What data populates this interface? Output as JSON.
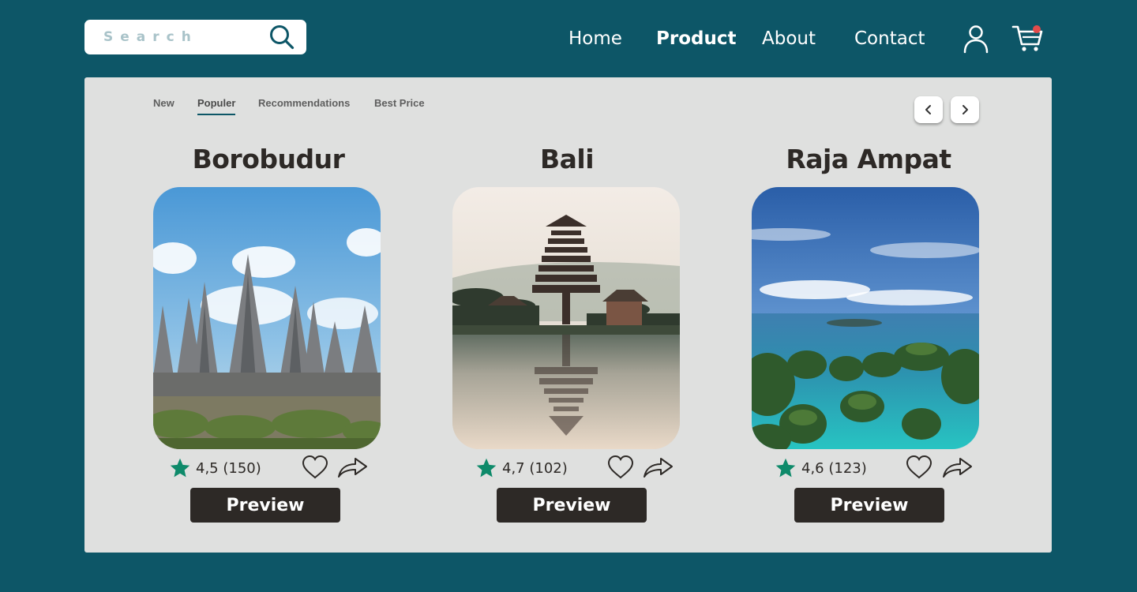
{
  "search": {
    "placeholder": "Search",
    "icon": "search-icon"
  },
  "nav": {
    "items": [
      {
        "label": "Home",
        "active": false
      },
      {
        "label": "Product",
        "active": true
      },
      {
        "label": "About",
        "active": false
      },
      {
        "label": "Contact",
        "active": false
      }
    ],
    "user_icon": "user-icon",
    "cart_icon": "cart-icon",
    "cart_badge_color": "#e24b4b"
  },
  "tabs": [
    {
      "label": "New",
      "active": false
    },
    {
      "label": "Populer",
      "active": true
    },
    {
      "label": "Recommendations",
      "active": false
    },
    {
      "label": "Best Price",
      "active": false
    }
  ],
  "carousel": {
    "prev_icon": "chevron-left-icon",
    "next_icon": "chevron-right-icon"
  },
  "cards": [
    {
      "title": "Borobudur",
      "rating": "4,5 (150)",
      "button": "Preview"
    },
    {
      "title": "Bali",
      "rating": "4,7 (102)",
      "button": "Preview"
    },
    {
      "title": "Raja Ampat",
      "rating": "4,6 (123)",
      "button": "Preview"
    }
  ],
  "colors": {
    "background": "#0d5667",
    "panel": "#dfe0df",
    "star": "#0e8a6a",
    "button": "#2d2926",
    "text": "#2d2926"
  }
}
